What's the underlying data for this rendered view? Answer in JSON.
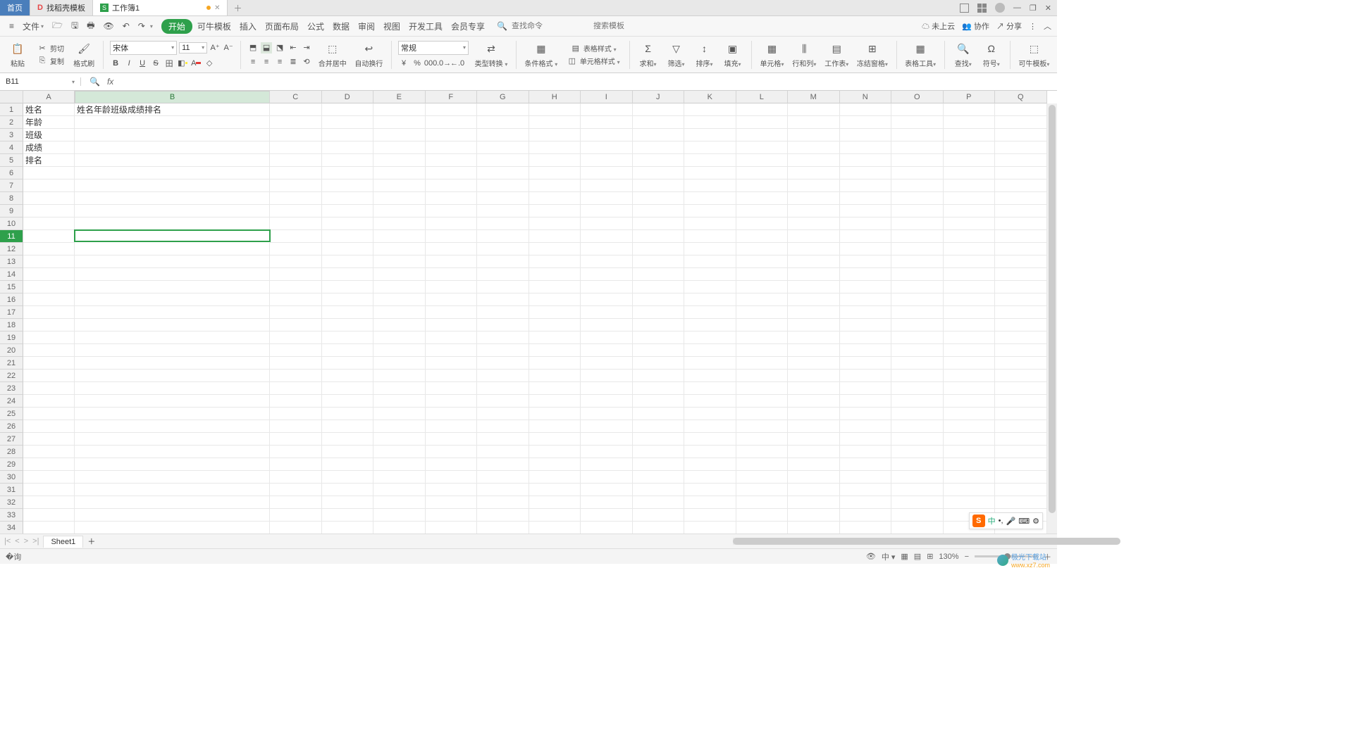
{
  "tabs": {
    "home": "首页",
    "template": "找稻壳模板",
    "workbook": "工作簿1"
  },
  "menu": {
    "file": "文件",
    "start": "开始",
    "kntpl": "可牛模板",
    "insert": "插入",
    "layout": "页面布局",
    "formula": "公式",
    "data": "数据",
    "review": "审阅",
    "view": "视图",
    "dev": "开发工具",
    "member": "会员专享"
  },
  "search": {
    "cmd": "查找命令",
    "tpl": "搜索模板"
  },
  "topright": {
    "cloud": "未上云",
    "collab": "协作",
    "share": "分享"
  },
  "ribbon": {
    "paste": "粘贴",
    "cut": "剪切",
    "copy": "复制",
    "painter": "格式刷",
    "font": "宋体",
    "size": "11",
    "merge": "合并居中",
    "wrap": "自动换行",
    "numfmt": "常规",
    "typeconv": "类型转换",
    "condfmt": "条件格式",
    "tblstyle": "表格样式",
    "cellstyle": "单元格样式",
    "sum": "求和",
    "filter": "筛选",
    "sort": "排序",
    "fill": "填充",
    "cells": "单元格",
    "rowcol": "行和列",
    "ws": "工作表",
    "freeze": "冻结窗格",
    "tbltool": "表格工具",
    "find": "查找",
    "symbol": "符号",
    "kntpl2": "可牛模板"
  },
  "namebox": "B11",
  "colHeaders": [
    "A",
    "B",
    "C",
    "D",
    "E",
    "F",
    "G",
    "H",
    "I",
    "J",
    "K",
    "L",
    "M",
    "N",
    "O",
    "P",
    "Q"
  ],
  "rowCount": 34,
  "cells": {
    "A1": "姓名",
    "A2": "年龄",
    "A3": "班级",
    "A4": "成绩",
    "A5": "排名",
    "B1": "姓名年龄班级成绩排名"
  },
  "selectedCell": "B11",
  "sheet": "Sheet1",
  "zoom": "130%",
  "watermark": {
    "name": "极光下载站",
    "url": "www.xz7.com"
  }
}
